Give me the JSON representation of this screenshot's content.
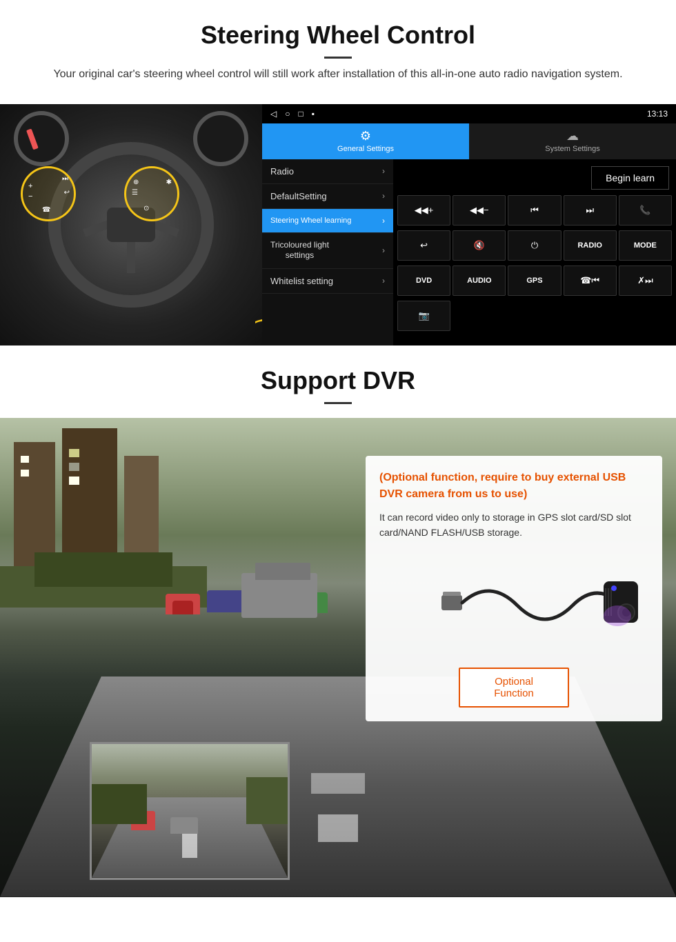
{
  "section1": {
    "title": "Steering Wheel Control",
    "subtitle": "Your original car's steering wheel control will still work after installation of this all-in-one auto radio navigation system.",
    "divider": true
  },
  "android_ui": {
    "statusbar": {
      "back_icon": "◁",
      "home_icon": "○",
      "recent_icon": "□",
      "menu_icon": "▪",
      "time": "13:13",
      "signal_icon": "▾",
      "wifi_icon": "▾"
    },
    "tabs": [
      {
        "label": "General Settings",
        "icon": "⚙",
        "active": true
      },
      {
        "label": "System Settings",
        "icon": "☁",
        "active": false
      }
    ],
    "menu_items": [
      {
        "label": "Radio",
        "active": false
      },
      {
        "label": "DefaultSetting",
        "active": false
      },
      {
        "label": "Steering Wheel learning",
        "active": true
      },
      {
        "label": "Tricoloured light settings",
        "active": false
      },
      {
        "label": "Whitelist setting",
        "active": false
      }
    ],
    "begin_learn": "Begin learn",
    "control_buttons_row1": [
      {
        "label": "▐◀+",
        "type": "icon"
      },
      {
        "label": "▐◀−",
        "type": "icon"
      },
      {
        "label": "◀◀",
        "type": "icon"
      },
      {
        "label": "▶▶",
        "type": "icon"
      },
      {
        "label": "☎",
        "type": "icon"
      }
    ],
    "control_buttons_row2": [
      {
        "label": "↩",
        "type": "icon"
      },
      {
        "label": "◀×",
        "type": "icon"
      },
      {
        "label": "⏻",
        "type": "icon"
      },
      {
        "label": "RADIO",
        "type": "text"
      },
      {
        "label": "MODE",
        "type": "text"
      }
    ],
    "control_buttons_row3": [
      {
        "label": "DVD",
        "type": "text"
      },
      {
        "label": "AUDIO",
        "type": "text"
      },
      {
        "label": "GPS",
        "type": "text"
      },
      {
        "label": "☎◀◀",
        "type": "icon"
      },
      {
        "label": "✗▶▶",
        "type": "icon"
      }
    ],
    "control_buttons_row4": [
      {
        "label": "📷",
        "type": "icon"
      }
    ]
  },
  "section2": {
    "title": "Support DVR",
    "optional_text": "(Optional function, require to buy external USB DVR camera from us to use)",
    "description": "It can record video only to storage in GPS slot card/SD slot card/NAND FLASH/USB storage.",
    "optional_button": "Optional Function"
  }
}
